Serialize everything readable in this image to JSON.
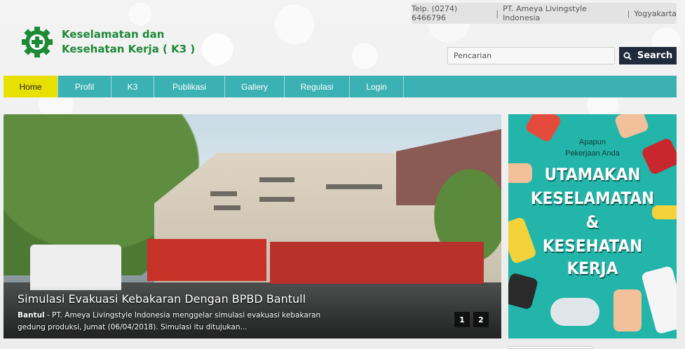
{
  "topbar": {
    "phone": "Telp. (0274) 6466796",
    "company": "PT. Ameya Livingstyle Indonesia",
    "city": "Yogyakarta"
  },
  "logo": {
    "line1": "Keselamatan dan",
    "line2": "Kesehatan Kerja ( K3 )",
    "icon": "gear-cross-icon",
    "color": "#1d8a36"
  },
  "search": {
    "placeholder": "Pencarian",
    "button_label": "Search"
  },
  "nav": {
    "items": [
      {
        "label": "Home",
        "active": true
      },
      {
        "label": "Profil"
      },
      {
        "label": "K3"
      },
      {
        "label": "Publikasi"
      },
      {
        "label": "Gallery"
      },
      {
        "label": "Regulasi"
      },
      {
        "label": "Login"
      }
    ],
    "color": "#3bb1b3",
    "active_color": "#e8e000"
  },
  "slider": {
    "title": "Simulasi Evakuasi Kebakaran Dengan BPBD Bantull",
    "desc_place": "Bantul",
    "desc_text": " - PT. Ameya Livingstyle Indonesia menggelar simulasi evakuasi kebakaran gedung produksi, Jumat (06/04/2018). Simulasi itu ditujukan...",
    "pages": [
      "1",
      "2"
    ]
  },
  "poster": {
    "line1": "Apapun",
    "line2": "Pekerjaan Anda",
    "line3": "UTAMAKAN",
    "line4": "KESELAMATAN",
    "line5": "&",
    "line6": "KESEHATAN",
    "line7": "KERJA",
    "color": "#23b5a9"
  }
}
